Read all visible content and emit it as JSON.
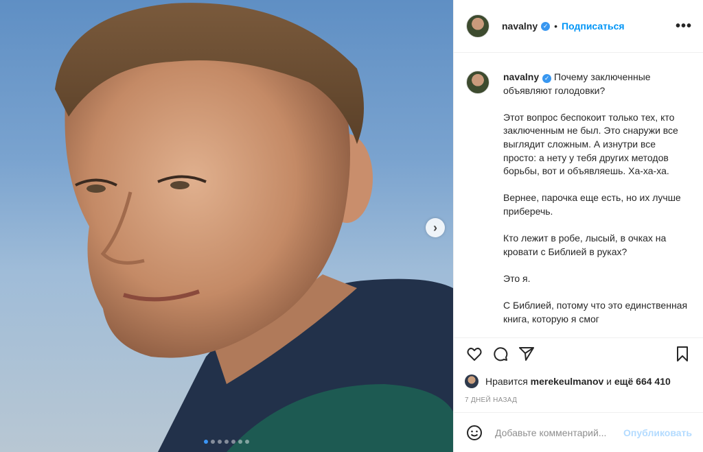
{
  "post": {
    "username": "navalny",
    "follow_label": "Подписаться",
    "separator": "•",
    "more_label": "•••"
  },
  "caption": {
    "username": "navalny",
    "paragraphs": [
      "Почему заключенные объявляют голодовки?",
      "Этот вопрос беспокоит только тех, кто заключенным не был. Это снаружи все выглядит сложным. А изнутри все просто: а нету у тебя других методов борьбы, вот и объявляешь. Ха-ха-ха.",
      "Вернее, парочка еще есть, но их лучше приберечь.",
      "Кто лежит в робе, лысый, в очках на кровати с Библией в руках?",
      "Это я.",
      "С Библией, потому что это единственная книга, которую я смог"
    ]
  },
  "likes": {
    "prefix": "Нравится",
    "user": "merekeulmanov",
    "conjunction": "и",
    "rest": "ещё 664 410"
  },
  "timestamp": "7 дней назад",
  "comment": {
    "placeholder": "Добавьте комментарий...",
    "publish_label": "Опубликовать"
  },
  "carousel": {
    "next_label": "›",
    "slide_count": 7,
    "active_index": 0
  },
  "colors": {
    "accent": "#0095f6",
    "verified": "#3897f0",
    "publish_disabled": "#b3dbff",
    "active_dot": "#3b95f5"
  },
  "icons": [
    "heart-icon",
    "comment-icon",
    "share-icon",
    "bookmark-icon",
    "emoji-icon",
    "verified-icon"
  ]
}
